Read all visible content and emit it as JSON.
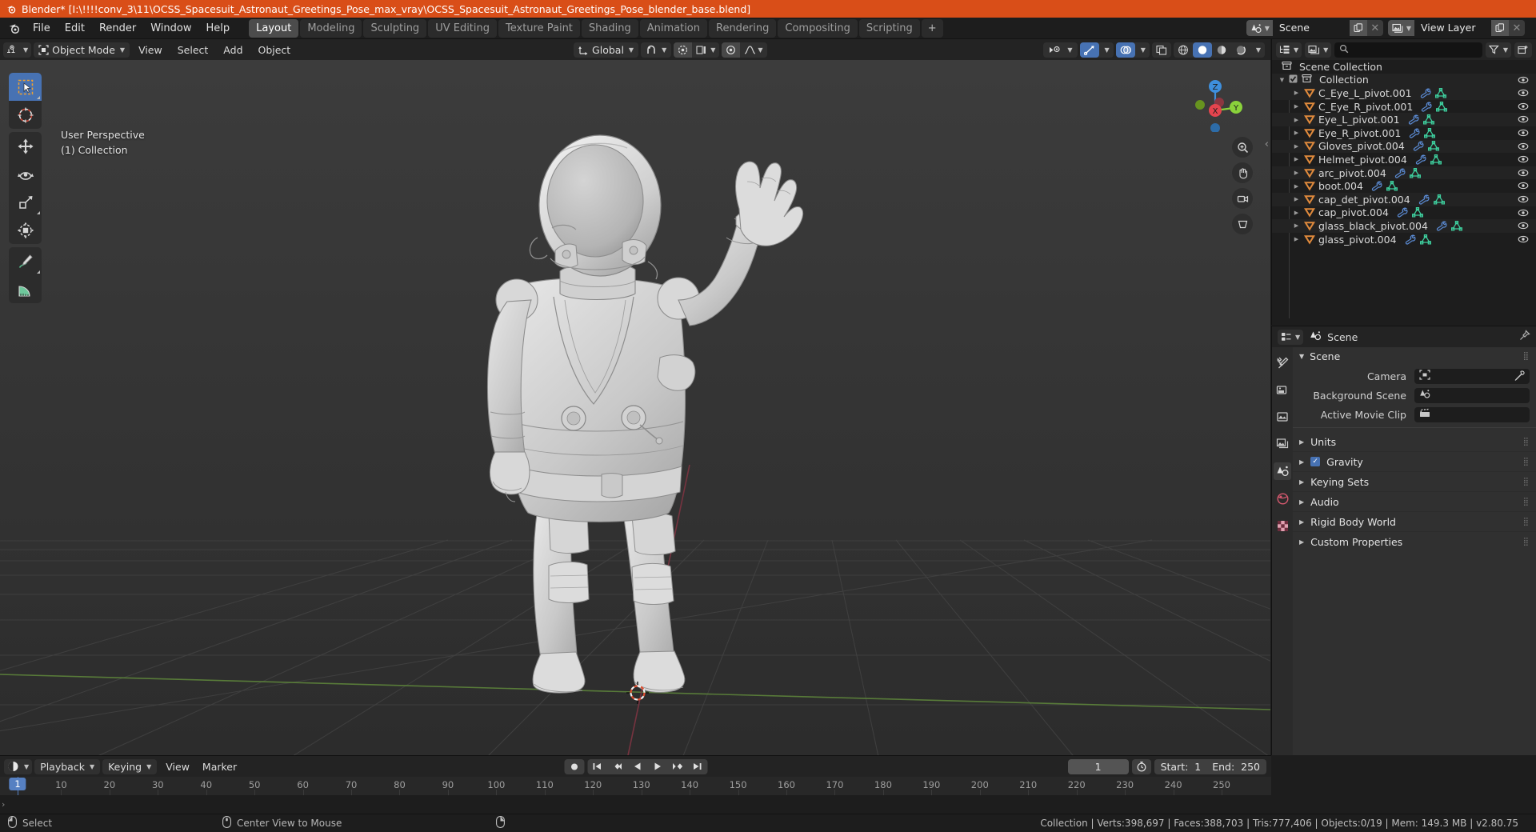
{
  "window": {
    "title": "Blender* [I:\\!!!!conv_3\\11\\OCSS_Spacesuit_Astronaut_Greetings_Pose_max_vray\\OCSS_Spacesuit_Astronaut_Greetings_Pose_blender_base.blend]",
    "logo_icon": "blender-logo-icon",
    "accent_color": "#d94e18",
    "highlight_color": "#4772b3"
  },
  "topbar": {
    "app_icon": "blender-menu-icon",
    "menus": [
      "File",
      "Edit",
      "Render",
      "Window",
      "Help"
    ],
    "workspaces": [
      {
        "label": "Layout",
        "active": true
      },
      {
        "label": "Modeling",
        "active": false
      },
      {
        "label": "Sculpting",
        "active": false
      },
      {
        "label": "UV Editing",
        "active": false
      },
      {
        "label": "Texture Paint",
        "active": false
      },
      {
        "label": "Shading",
        "active": false
      },
      {
        "label": "Animation",
        "active": false
      },
      {
        "label": "Rendering",
        "active": false
      },
      {
        "label": "Compositing",
        "active": false
      },
      {
        "label": "Scripting",
        "active": false
      }
    ],
    "add_workspace_label": "+",
    "scene": {
      "icon": "scene-icon",
      "name": "Scene",
      "new_icon": "new-scene-icon",
      "unlink_icon": "unlink-icon"
    },
    "view_layer": {
      "icon": "view-layer-icon",
      "name": "View Layer",
      "new_icon": "new-layer-icon",
      "unlink_icon": "unlink-icon"
    }
  },
  "viewport": {
    "header": {
      "editor_type_icon": "editor-type-3dview-icon",
      "mode": "Object Mode",
      "menus": [
        "View",
        "Select",
        "Add",
        "Object"
      ],
      "transform_orientation": "Global",
      "snap_icon": "snap-magnet-icon",
      "proportional_icon": "proportional-edit-icon",
      "pivot_icon": "pivot-point-icon",
      "falloff_icon": "falloff-curve-icon",
      "visibility_icon": "visibility-eye-icon",
      "gizmo_icon": "gizmo-icon",
      "overlays_icon": "overlays-icon",
      "xray_icon": "xray-toggle-icon",
      "shading_modes": [
        "wireframe",
        "solid",
        "material-preview",
        "rendered"
      ],
      "active_shading": "solid"
    },
    "overlay": {
      "perspective": "User Perspective",
      "collection": "(1) Collection"
    },
    "tools": [
      {
        "name": "tweak-select-tool",
        "active": true
      },
      {
        "name": "cursor-tool",
        "active": false
      },
      {
        "name": "move-tool",
        "active": false
      },
      {
        "name": "rotate-tool",
        "active": false
      },
      {
        "name": "scale-tool",
        "active": false
      },
      {
        "name": "transform-tool",
        "active": false
      },
      {
        "name": "annotate-tool",
        "active": false
      },
      {
        "name": "measure-tool",
        "active": false
      }
    ],
    "gizmo_axes": [
      {
        "label": "X",
        "color": "#e4444e"
      },
      {
        "label": "Y",
        "color": "#8ad23b"
      },
      {
        "label": "Z",
        "color": "#3e8fdd"
      }
    ],
    "nav_buttons": [
      "zoom-icon",
      "camera-icon",
      "hand-pan-icon",
      "magnifier-icon",
      "perspective-toggle-icon"
    ],
    "scene_object": "astronaut-spacesuit-model"
  },
  "outliner": {
    "header": {
      "editor_type_icon": "editor-type-outliner-icon",
      "display_mode_icon": "outliner-display-mode-icon",
      "search_placeholder": "",
      "search_icon": "search-icon",
      "filter_icon": "filter-funnel-icon",
      "new_collection_icon": "new-collection-icon"
    },
    "scene_collection": {
      "label": "Scene Collection",
      "icon": "collection-icon"
    },
    "collection": {
      "label": "Collection",
      "icon": "collection-icon",
      "checked": true,
      "expanded": true
    },
    "items": [
      {
        "label": "C_Eye_L_pivot.001",
        "icon": "empty-arrows-icon",
        "data_icons": [
          "modifier-wrench-icon",
          "mesh-data-icon"
        ]
      },
      {
        "label": "C_Eye_R_pivot.001",
        "icon": "empty-arrows-icon",
        "data_icons": [
          "modifier-wrench-icon",
          "mesh-data-icon"
        ]
      },
      {
        "label": "Eye_L_pivot.001",
        "icon": "empty-arrows-icon",
        "data_icons": [
          "modifier-wrench-icon",
          "mesh-data-icon"
        ]
      },
      {
        "label": "Eye_R_pivot.001",
        "icon": "empty-arrows-icon",
        "data_icons": [
          "modifier-wrench-icon",
          "mesh-data-icon"
        ]
      },
      {
        "label": "Gloves_pivot.004",
        "icon": "empty-arrows-icon",
        "data_icons": [
          "modifier-wrench-icon",
          "mesh-data-icon"
        ]
      },
      {
        "label": "Helmet_pivot.004",
        "icon": "empty-arrows-icon",
        "data_icons": [
          "modifier-wrench-icon",
          "mesh-data-icon"
        ]
      },
      {
        "label": "arc_pivot.004",
        "icon": "empty-arrows-icon",
        "data_icons": [
          "modifier-wrench-icon",
          "mesh-data-icon"
        ]
      },
      {
        "label": "boot.004",
        "icon": "empty-arrows-icon",
        "data_icons": [
          "modifier-wrench-icon",
          "mesh-data-icon"
        ]
      },
      {
        "label": "cap_det_pivot.004",
        "icon": "empty-arrows-icon",
        "data_icons": [
          "modifier-wrench-icon",
          "mesh-data-icon"
        ]
      },
      {
        "label": "cap_pivot.004",
        "icon": "empty-arrows-icon",
        "data_icons": [
          "modifier-wrench-icon",
          "mesh-data-icon"
        ]
      },
      {
        "label": "glass_black_pivot.004",
        "icon": "empty-arrows-icon",
        "data_icons": [
          "modifier-wrench-icon",
          "mesh-data-icon"
        ]
      },
      {
        "label": "glass_pivot.004",
        "icon": "empty-arrows-icon",
        "data_icons": [
          "modifier-wrench-icon",
          "mesh-data-icon"
        ]
      }
    ]
  },
  "properties": {
    "header": {
      "editor_type_icon": "editor-type-properties-icon",
      "breadcrumb_icon": "scene-icon",
      "breadcrumb": "Scene",
      "pin_icon": "pin-icon"
    },
    "tabs": [
      {
        "name": "tool-tab",
        "icon": "tool-wrench-screwdriver-icon",
        "active": false
      },
      {
        "name": "render-tab",
        "icon": "render-camera-back-icon",
        "active": false
      },
      {
        "name": "output-tab",
        "icon": "output-printer-icon",
        "active": false
      },
      {
        "name": "view-layer-tab",
        "icon": "view-layer-images-icon",
        "active": false
      },
      {
        "name": "scene-tab",
        "icon": "scene-cone-sphere-icon",
        "active": true
      },
      {
        "name": "world-tab",
        "icon": "world-globe-icon",
        "active": false
      },
      {
        "name": "texture-tab",
        "icon": "texture-checker-icon",
        "active": false
      }
    ],
    "panel": {
      "title": "Scene",
      "expanded": true,
      "rows": [
        {
          "label": "Camera",
          "value": "",
          "icon": "camera-data-icon",
          "has_eyedropper": true
        },
        {
          "label": "Background Scene",
          "value": "",
          "icon": "scene-icon",
          "has_eyedropper": false
        },
        {
          "label": "Active Movie Clip",
          "value": "",
          "icon": "movie-clip-icon",
          "has_eyedropper": false
        }
      ]
    },
    "sections": [
      {
        "label": "Units",
        "expanded": false,
        "checkbox": null
      },
      {
        "label": "Gravity",
        "expanded": false,
        "checkbox": true
      },
      {
        "label": "Keying Sets",
        "expanded": false,
        "checkbox": null
      },
      {
        "label": "Audio",
        "expanded": false,
        "checkbox": null
      },
      {
        "label": "Rigid Body World",
        "expanded": false,
        "checkbox": null
      },
      {
        "label": "Custom Properties",
        "expanded": false,
        "checkbox": null
      }
    ]
  },
  "timeline": {
    "header": {
      "editor_type_icon": "editor-type-timeline-icon",
      "menus_dropdown": [
        "Playback",
        "Keying"
      ],
      "menus": [
        "View",
        "Marker"
      ],
      "transport": [
        {
          "name": "record-keyframes-button",
          "icon": "record-dot-icon"
        },
        {
          "name": "jump-to-start-button",
          "icon": "jump-start-icon"
        },
        {
          "name": "jump-to-prev-keyframe-button",
          "icon": "prev-keyframe-icon"
        },
        {
          "name": "play-reverse-button",
          "icon": "play-reverse-icon"
        },
        {
          "name": "play-button",
          "icon": "play-icon"
        },
        {
          "name": "jump-to-next-keyframe-button",
          "icon": "next-keyframe-icon"
        },
        {
          "name": "jump-to-end-button",
          "icon": "jump-end-icon"
        }
      ],
      "current_frame": "1",
      "use_preview_range_icon": "stopwatch-icon",
      "start_label": "Start:",
      "start_value": "1",
      "end_label": "End:",
      "end_value": "250"
    },
    "playhead_frame": 1,
    "ticks": [
      1,
      10,
      20,
      30,
      40,
      50,
      60,
      70,
      80,
      90,
      100,
      110,
      120,
      130,
      140,
      150,
      160,
      170,
      180,
      190,
      200,
      210,
      220,
      230,
      240,
      250
    ]
  },
  "statusbar": {
    "hints": [
      {
        "icon": "mouse-left-button-icon",
        "label": "Select"
      },
      {
        "icon": "mouse-middle-button-icon",
        "label": "Center View to Mouse"
      },
      {
        "icon": "mouse-right-button-icon",
        "label": ""
      }
    ],
    "stats": "Collection | Verts:398,697 | Faces:388,703 | Tris:777,406 | Objects:0/19 | Mem: 149.3 MB | v2.80.75"
  }
}
